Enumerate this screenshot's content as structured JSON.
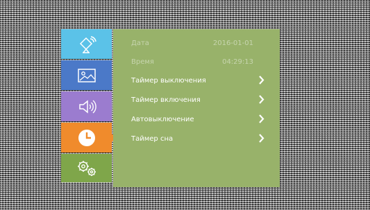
{
  "sidebar": {
    "items": [
      {
        "icon": "satellite-icon",
        "color": "#5bc2e8"
      },
      {
        "icon": "picture-icon",
        "color": "#4b79c8"
      },
      {
        "icon": "speaker-icon",
        "color": "#9b7ccf"
      },
      {
        "icon": "clock-icon",
        "color": "#f08b2c",
        "selected": true
      },
      {
        "icon": "gears-icon",
        "color": "#7fa64a"
      }
    ]
  },
  "panel": {
    "date": {
      "label": "Дата",
      "value": "2016-01-01"
    },
    "time": {
      "label": "Время",
      "value": "04:29:13"
    },
    "items": [
      {
        "label": "Таймер выключения"
      },
      {
        "label": "Таймер включения"
      },
      {
        "label": "Автовыключение"
      },
      {
        "label": "Таймер сна"
      }
    ],
    "background_color": "#98b26a"
  }
}
